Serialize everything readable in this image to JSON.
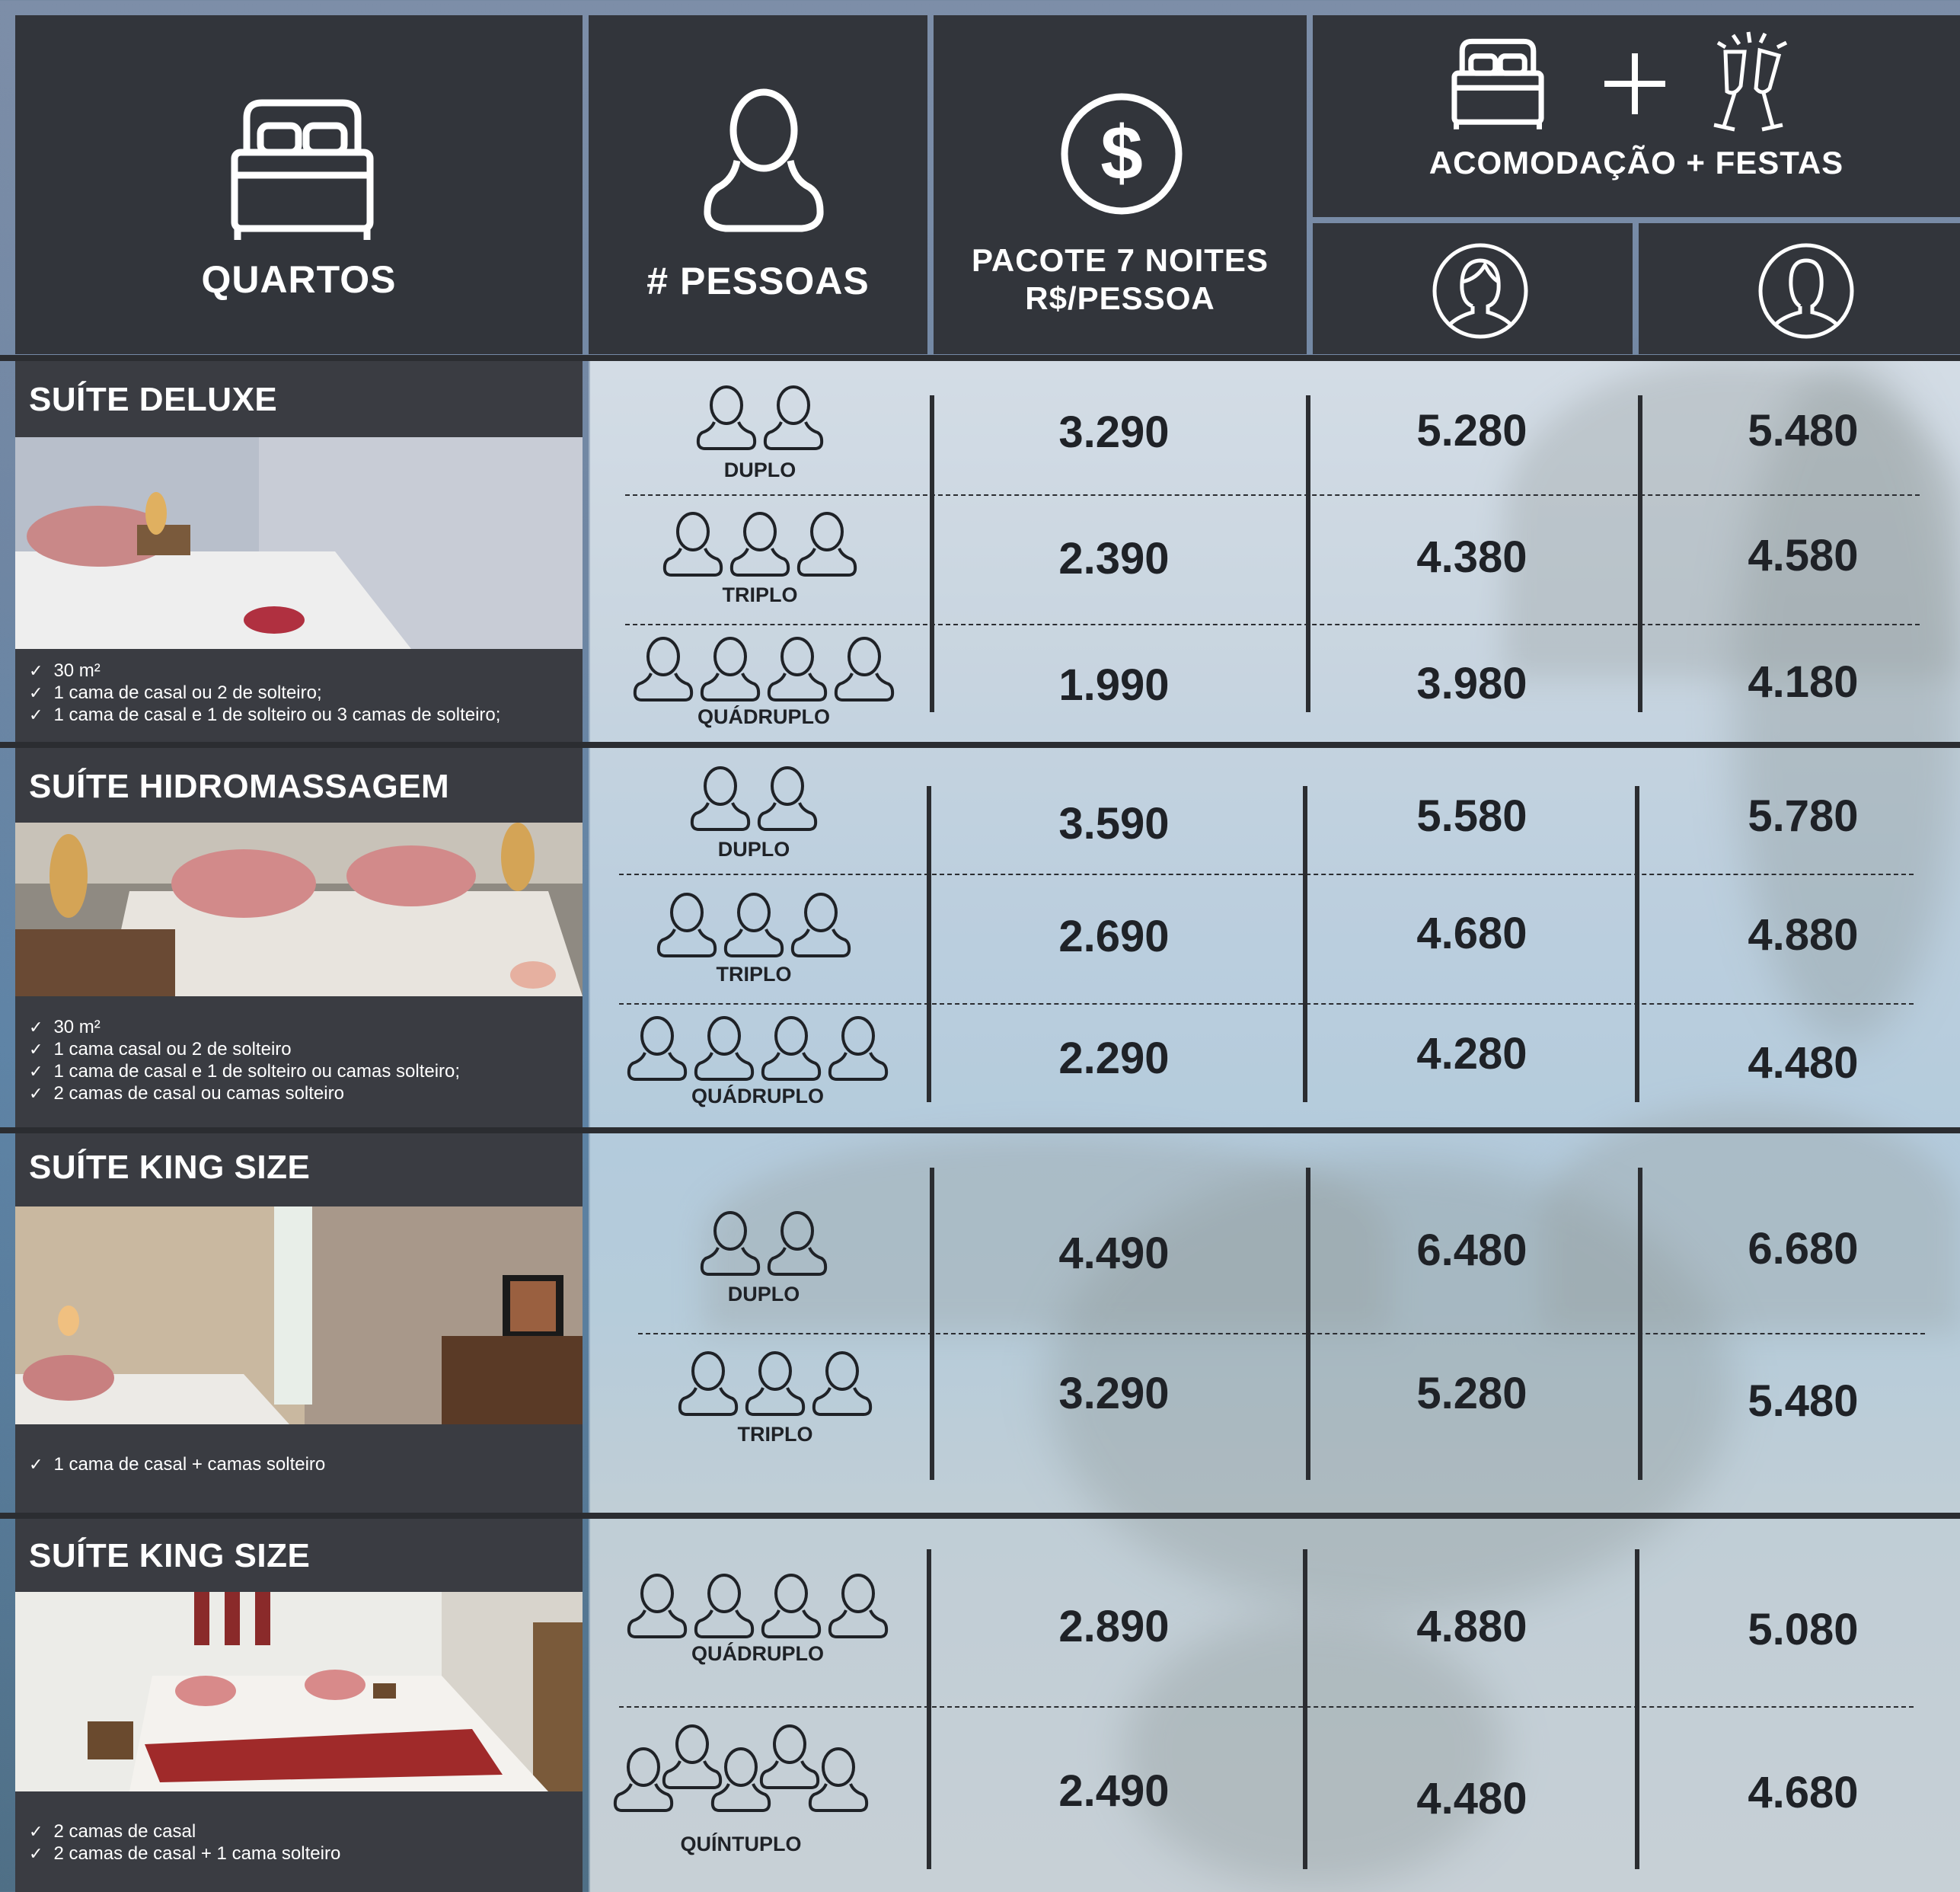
{
  "header": {
    "col_rooms": "QUARTOS",
    "col_people": "# PESSOAS",
    "col_package_line1": "PACOTE 7 NOITES",
    "col_package_line2": "R$/PESSOA",
    "col_combo": "ACOMODAÇÃO + FESTAS",
    "icons": [
      "bed-icon",
      "person-icon",
      "dollar-icon",
      "bed-icon",
      "plus-icon",
      "champagne-icon",
      "female-avatar-icon",
      "male-avatar-icon"
    ]
  },
  "sections": [
    {
      "title": "SUÍTE DELUXE",
      "features": [
        "30 m²",
        "1 cama de casal ou 2 de solteiro;",
        "1 cama de casal e 1 de solteiro ou 3 camas de solteiro;"
      ],
      "rows": [
        {
          "label": "DUPLO",
          "count": 2,
          "pkg": "3.290",
          "female": "5.280",
          "male": "5.480"
        },
        {
          "label": "TRIPLO",
          "count": 3,
          "pkg": "2.390",
          "female": "4.380",
          "male": "4.580"
        },
        {
          "label": "QUÁDRUPLO",
          "count": 4,
          "pkg": "1.990",
          "female": "3.980",
          "male": "4.180"
        }
      ]
    },
    {
      "title": "SUÍTE HIDROMASSAGEM",
      "features": [
        "30 m²",
        "1 cama casal ou 2 de solteiro",
        "1 cama de casal e 1 de solteiro ou camas solteiro;",
        "2 camas de casal ou camas solteiro"
      ],
      "rows": [
        {
          "label": "DUPLO",
          "count": 2,
          "pkg": "3.590",
          "female": "5.580",
          "male": "5.780"
        },
        {
          "label": "TRIPLO",
          "count": 3,
          "pkg": "2.690",
          "female": "4.680",
          "male": "4.880"
        },
        {
          "label": "QUÁDRUPLO",
          "count": 4,
          "pkg": "2.290",
          "female": "4.280",
          "male": "4.480"
        }
      ]
    },
    {
      "title": "SUÍTE KING SIZE",
      "features": [
        "1 cama de casal + camas solteiro"
      ],
      "rows": [
        {
          "label": "DUPLO",
          "count": 2,
          "pkg": "4.490",
          "female": "6.480",
          "male": "6.680"
        },
        {
          "label": "TRIPLO",
          "count": 3,
          "pkg": "3.290",
          "female": "5.280",
          "male": "5.480"
        }
      ]
    },
    {
      "title": "SUÍTE KING SIZE",
      "features": [
        "2 camas de casal",
        "2 camas de casal + 1 cama solteiro"
      ],
      "rows": [
        {
          "label": "QUÁDRUPLO",
          "count": 4,
          "pkg": "2.890",
          "female": "4.880",
          "male": "5.080"
        },
        {
          "label": "QUÍNTUPLO",
          "count": 5,
          "pkg": "2.490",
          "female": "4.480",
          "male": "4.680"
        }
      ]
    }
  ]
}
